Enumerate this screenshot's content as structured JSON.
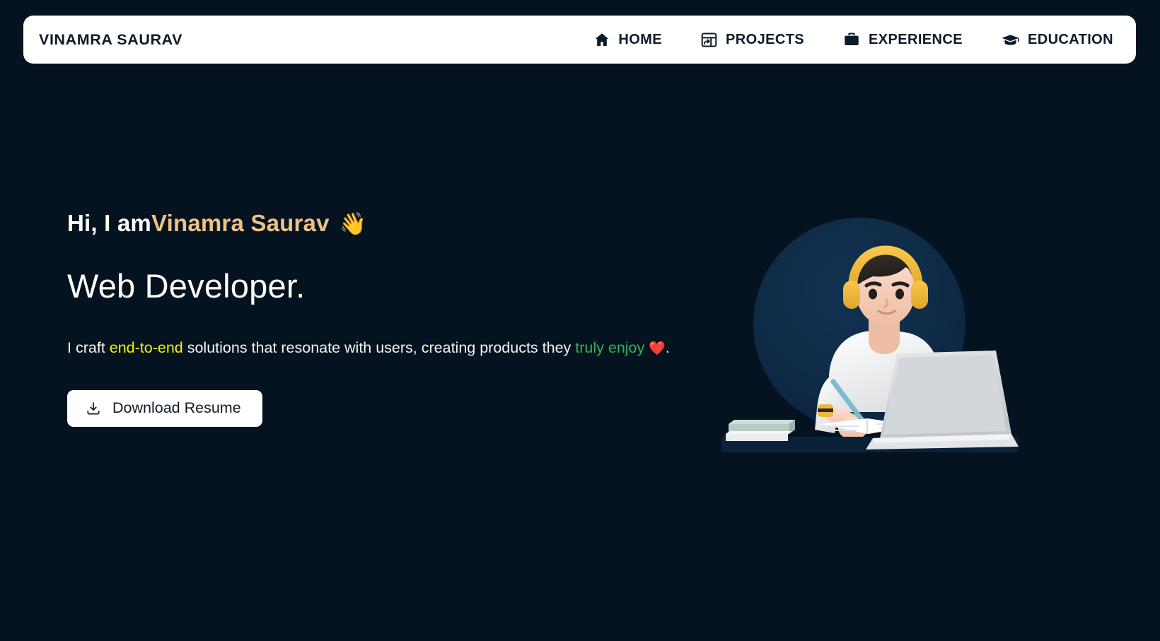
{
  "brand": {
    "name": "VINAMRA SAURAV"
  },
  "nav": {
    "items": [
      {
        "label": "HOME",
        "icon": "home-icon"
      },
      {
        "label": "PROJECTS",
        "icon": "projects-icon"
      },
      {
        "label": "EXPERIENCE",
        "icon": "briefcase-icon"
      },
      {
        "label": "EDUCATION",
        "icon": "graduation-cap-icon"
      }
    ]
  },
  "hero": {
    "greeting_prefix": "Hi, I am ",
    "greeting_name": "Vinamra Saurav",
    "greeting_emoji": "👋",
    "role": "Web Developer.",
    "tagline": {
      "part1": "I craft ",
      "highlight1": "end-to-end",
      "part2": " solutions that resonate with users, creating products they ",
      "highlight2": "truly enjoy",
      "emoji": "❤️",
      "part3": "."
    },
    "resume_button": {
      "label": "Download Resume",
      "icon": "download-icon"
    },
    "illustration": {
      "name": "developer-at-laptop-illustration",
      "alt": "3D illustration of a person wearing yellow headphones writing in a notebook while working on a laptop"
    }
  },
  "colors": {
    "background": "#04131f",
    "navbar": "#ffffff",
    "brand_text": "#0a1b2a",
    "accent_gold": "#efc183",
    "accent_yellow": "#f4ee18",
    "accent_green": "#2fb457",
    "button_bg": "#ffffff",
    "button_text": "#101b26",
    "illustration_circle": "#0e2a46"
  }
}
